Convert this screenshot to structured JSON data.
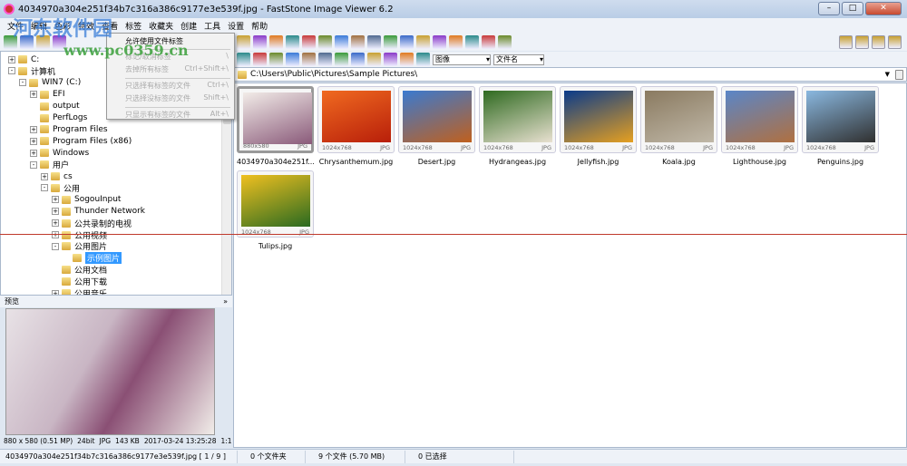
{
  "window": {
    "title": "4034970a304e251f34b7c316a386c9177e3e539f.jpg  -  FastStone Image Viewer 6.2",
    "buttons": [
      "–",
      "□",
      "✕"
    ]
  },
  "menu": [
    "文件",
    "编辑",
    "色彩",
    "特效",
    "查看",
    "标签",
    "收藏夹",
    "创建",
    "工具",
    "设置",
    "帮助"
  ],
  "tag_menu": [
    {
      "label": "允许使用文件标签",
      "shortcut": "",
      "enabled": true
    },
    {
      "label": "标记/取消标签",
      "shortcut": "\\",
      "enabled": false
    },
    {
      "label": "去掉所有标签",
      "shortcut": "Ctrl+Shift+\\",
      "enabled": false
    },
    {
      "label": "只选择有标签的文件",
      "shortcut": "Ctrl+\\",
      "enabled": false
    },
    {
      "label": "只选择没标签的文件",
      "shortcut": "Shift+\\",
      "enabled": false
    },
    {
      "label": "只显示有标签的文件",
      "shortcut": "Alt+\\",
      "enabled": false
    }
  ],
  "toolbar": {
    "filter_value": "图像",
    "sort_value": "文件名"
  },
  "address": "C:\\Users\\Public\\Pictures\\Sample Pictures\\",
  "tree": [
    {
      "label": "C:",
      "level": 0,
      "exp": "+"
    },
    {
      "label": "计算机",
      "level": 0,
      "exp": "-"
    },
    {
      "label": "WIN7 (C:)",
      "level": 1,
      "exp": "-"
    },
    {
      "label": "EFI",
      "level": 2,
      "exp": "+"
    },
    {
      "label": "output",
      "level": 2,
      "exp": ""
    },
    {
      "label": "PerfLogs",
      "level": 2,
      "exp": ""
    },
    {
      "label": "Program Files",
      "level": 2,
      "exp": "+"
    },
    {
      "label": "Program Files (x86)",
      "level": 2,
      "exp": "+"
    },
    {
      "label": "Windows",
      "level": 2,
      "exp": "+"
    },
    {
      "label": "用户",
      "level": 2,
      "exp": "-"
    },
    {
      "label": "cs",
      "level": 3,
      "exp": "+"
    },
    {
      "label": "公用",
      "level": 3,
      "exp": "-"
    },
    {
      "label": "SogouInput",
      "level": 4,
      "exp": "+"
    },
    {
      "label": "Thunder Network",
      "level": 4,
      "exp": "+"
    },
    {
      "label": "公共录制的电视",
      "level": 4,
      "exp": "+"
    },
    {
      "label": "公用视频",
      "level": 4,
      "exp": "+"
    },
    {
      "label": "公用图片",
      "level": 4,
      "exp": "-"
    },
    {
      "label": "示例图片",
      "level": 5,
      "exp": "",
      "selected": true
    },
    {
      "label": "公用文档",
      "level": 4,
      "exp": ""
    },
    {
      "label": "公用下载",
      "level": 4,
      "exp": ""
    },
    {
      "label": "公用音乐",
      "level": 4,
      "exp": "+"
    }
  ],
  "preview": {
    "header": "预览",
    "collapse": "»",
    "info": [
      "880 x 580 (0.51 MP)",
      "24bit",
      "JPG",
      "143 KB",
      "2017-03-24 13:25:28",
      "1:1"
    ]
  },
  "thumbnails": [
    {
      "name": "4034970a304e251f...",
      "dims": "880x580",
      "type": "JPG",
      "colors": [
        "#f2ece8",
        "#8a5a7a"
      ]
    },
    {
      "name": "Chrysanthemum.jpg",
      "dims": "1024x768",
      "type": "JPG",
      "colors": [
        "#f06a20",
        "#b81f0a"
      ]
    },
    {
      "name": "Desert.jpg",
      "dims": "1024x768",
      "type": "JPG",
      "colors": [
        "#3a7ad0",
        "#c0601e"
      ]
    },
    {
      "name": "Hydrangeas.jpg",
      "dims": "1024x768",
      "type": "JPG",
      "colors": [
        "#2f6a20",
        "#e8e0d0"
      ]
    },
    {
      "name": "Jellyfish.jpg",
      "dims": "1024x768",
      "type": "JPG",
      "colors": [
        "#0a3a8a",
        "#e6a020"
      ]
    },
    {
      "name": "Koala.jpg",
      "dims": "1024x768",
      "type": "JPG",
      "colors": [
        "#8a7a60",
        "#c0b8a8"
      ]
    },
    {
      "name": "Lighthouse.jpg",
      "dims": "1024x768",
      "type": "JPG",
      "colors": [
        "#5a86c8",
        "#b07040"
      ]
    },
    {
      "name": "Penguins.jpg",
      "dims": "1024x768",
      "type": "JPG",
      "colors": [
        "#8ab8e0",
        "#303030"
      ]
    },
    {
      "name": "Tulips.jpg",
      "dims": "1024x768",
      "type": "JPG",
      "colors": [
        "#f0c020",
        "#2a6a20"
      ]
    }
  ],
  "status": {
    "file": "4034970a304e251f34b7c316a386c9177e3e539f.jpg [ 1 / 9 ]",
    "folders": "0 个文件夹",
    "files": "9 个文件 (5.70 MB)",
    "selected": "0 已选择"
  },
  "watermark": {
    "text": "河东软件园",
    "url": "www.pc0359.cn"
  }
}
